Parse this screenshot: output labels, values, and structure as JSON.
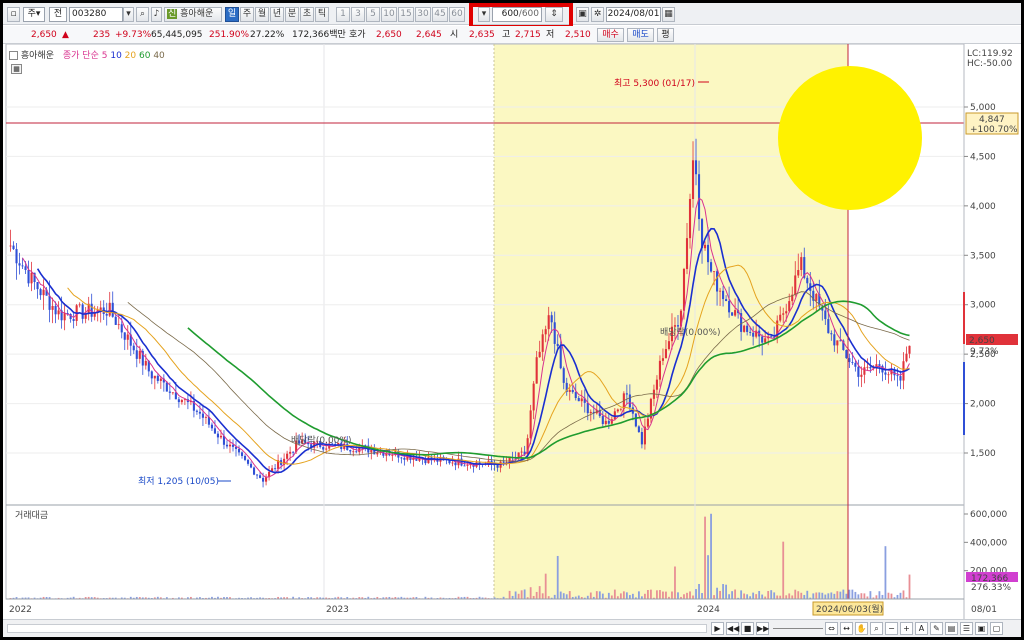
{
  "toolbar": {
    "market": "주",
    "period_mode": "전",
    "code": "003280",
    "stock_name": "흥아해운",
    "tabs": [
      "일",
      "주",
      "월",
      "년",
      "분",
      "초",
      "틱"
    ],
    "minute_options": [
      "1",
      "3",
      "5",
      "10",
      "15",
      "30",
      "45",
      "60"
    ],
    "count_display": "600",
    "count_total": "/600",
    "date": "2024/08/01"
  },
  "quote": {
    "price": "2,650",
    "change_arrow": "▲",
    "change": "235",
    "change_pct": "+9.73%",
    "volume": "65,445,095",
    "vol_ratio": "251.90%",
    "turnover": "27.22%",
    "amount": "172,366백만",
    "ask_label": "호가",
    "ask": "2,650",
    "bid": "2,645",
    "open_label": "시",
    "open": "2,635",
    "high_label": "고",
    "high": "2,715",
    "low_label": "저",
    "low": "2,510",
    "buy_btn": "매수",
    "sell_btn": "매도",
    "flat_btn": "평"
  },
  "legend": {
    "name": "흥아해운",
    "label": "종가 단순",
    "ma5": "5",
    "ma10": "10",
    "ma20": "20",
    "ma60": "60",
    "ma40": "40"
  },
  "price_axis": {
    "lc": "LC:119.92",
    "hc": "HC:-50.00",
    "ticks": [
      "5,000",
      "4,500",
      "4,000",
      "3,500",
      "3,000",
      "2,500",
      "2,000",
      "1,500"
    ],
    "crosshair_value": "4,847",
    "crosshair_pct": "+100.70%",
    "current_price": "2,650",
    "current_pct": "9.73%"
  },
  "volume_axis": {
    "label": "거래대금",
    "ticks": [
      "600,000",
      "400,000",
      "200,000"
    ],
    "current": "172,366",
    "current_pct": "276.33%"
  },
  "annotations": {
    "high": "최고 5,300 (01/17)",
    "low": "최저 1,205 (10/05)",
    "dividend1": "배당락(0.00%)",
    "dividend2": "배당락(0.00%)"
  },
  "time_axis": {
    "labels": [
      "2022",
      "2023",
      "2024"
    ],
    "crosshair_date": "2024/06/03(월)",
    "last": "08/01"
  },
  "colors": {
    "ma5": "#1a2fd0",
    "ma10": "#d9338f",
    "ma20": "#e5a31f",
    "ma60": "#1f9c2f",
    "ma40": "#7a6a4a",
    "up": "#e0323a",
    "down": "#2f4fd6",
    "highlight": "#fbf8c2",
    "sun": "#fff200",
    "crosshair": "#c2233b"
  },
  "chart_data": {
    "type": "line",
    "x": [
      "2022-01",
      "2022-04",
      "2022-07",
      "2022-10",
      "2023-01",
      "2023-04",
      "2023-07",
      "2023-10",
      "2024-01",
      "2024-04",
      "2024-06",
      "2024-08"
    ],
    "series": [
      {
        "name": "종가",
        "values": [
          3600,
          2900,
          2100,
          1300,
          1550,
          1500,
          1380,
          2500,
          4600,
          2700,
          2300,
          2650
        ]
      }
    ],
    "ylim": [
      1200,
      5300
    ]
  }
}
